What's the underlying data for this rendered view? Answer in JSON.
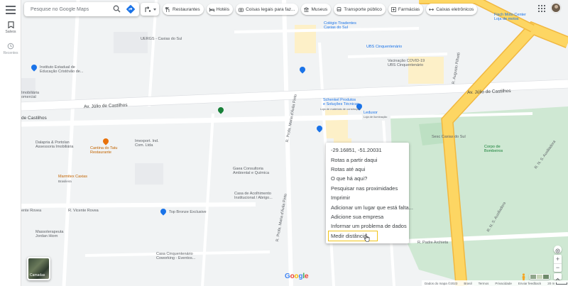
{
  "sidebar": {
    "saved_label": "Salvos",
    "recent_label": "Recentes"
  },
  "search": {
    "placeholder": "Pesquise no Google Maps"
  },
  "chips": [
    {
      "label": "Restaurantes",
      "icon": "fork-knife-icon"
    },
    {
      "label": "Hotéis",
      "icon": "bed-icon"
    },
    {
      "label": "Coisas legais para faz...",
      "icon": "camera-icon"
    },
    {
      "label": "Museus",
      "icon": "museum-icon"
    },
    {
      "label": "Transporte público",
      "icon": "bus-icon"
    },
    {
      "label": "Farmácias",
      "icon": "pharmacy-icon"
    },
    {
      "label": "Caixas eletrônicos",
      "icon": "atm-icon"
    }
  ],
  "map_labels": {
    "ufrgs": "UERGS - Caxias do Sul",
    "tiradentes": "Colégio Tiradentes\nCaxias do Sul",
    "ubs": "UBS Cinquentenário",
    "vacinacao": "Vacinação COVID-19\nUBS Cinquentenário",
    "fisch": "Fisch Moto Center\nLoja de motos",
    "instituto": "Instituto Estadual de\nEducação Cristóvão de...",
    "imobiliaria": "Imobiliária\nomercial",
    "schenkel": "Schenkel Produtos\ne Soluções Técnicas...",
    "schenkel_sub": "Loja de materiais de construção",
    "leduxor": "Leduxor",
    "leduxor_sub": "Loja de iluminação",
    "sesc": "Sesc Caxias do Sul",
    "dalapria": "Dalapria & Portolan\nAssessoria Imobiliária",
    "tatu": "Cantina do Tatu\nRestaurante",
    "imexport": "Imexport. Ind.\nCom. Ltda",
    "marmitex": "Marmitex Caxias",
    "marmitex_sub": "Brasileira",
    "gaea": "Gaea Consultoria\nAmbiental e Química",
    "acolhimento": "Casa de Acolhimento\nInstitucional / Abrigo...",
    "topbronze": "Top Bronze Exclusive",
    "massoterapia": "Massoterapeuta\nJordan Hiorn",
    "casa_cinq": "Casa Cinquentenário\nCoworking - Eventos...",
    "corpo": "Corpo de\nBombeiros",
    "st_julio_left": "Av. Júlio de Castilhos",
    "st_julio_right": "Av. Júlio de Castilhos",
    "st_castilhos": "de Castilhos",
    "st_vicente": "R. Vicente Rovea",
    "st_rovea": "ente Rovea",
    "st_paulo": "R. Padre Archieta",
    "st_dario": "R. Profa. Maria d'Ávila Pinto",
    "st_dario2": "R. Profa. Maria d'Ávila Pinto",
    "st_augusto": "R. Augusto Pilhetti",
    "st_rns": "R. N. S. Auxiliadora",
    "st_rns2": "R. N. S. Auxiliadora"
  },
  "context_menu": {
    "coords": "-29.16851, -51.20031",
    "items": [
      "Rotas a partir daqui",
      "Rotas até aqui",
      "O que há aqui?",
      "Pesquisar nas proximidades",
      "Imprimir",
      "Adicionar um lugar que está falta...",
      "Adicione sua empresa",
      "Informar um problema de dados"
    ],
    "highlighted": "Medir distância"
  },
  "thumb_label": "Camadas",
  "google_logo": [
    "G",
    "o",
    "o",
    "g",
    "l",
    "e"
  ],
  "logo_colors": [
    "#4285f4",
    "#ea4335",
    "#fbbc05",
    "#4285f4",
    "#34a853",
    "#ea4335"
  ],
  "footer": [
    "Dados do mapa ©2023",
    "Brasil",
    "Termos",
    "Privacidade",
    "Enviar feedback",
    "20 m"
  ],
  "colors": {
    "road_major": "#fdd663",
    "road_major_edge": "#f1b840",
    "park": "#cfe8d3",
    "building": "#fdf0c8",
    "accent": "#1a73e8"
  }
}
